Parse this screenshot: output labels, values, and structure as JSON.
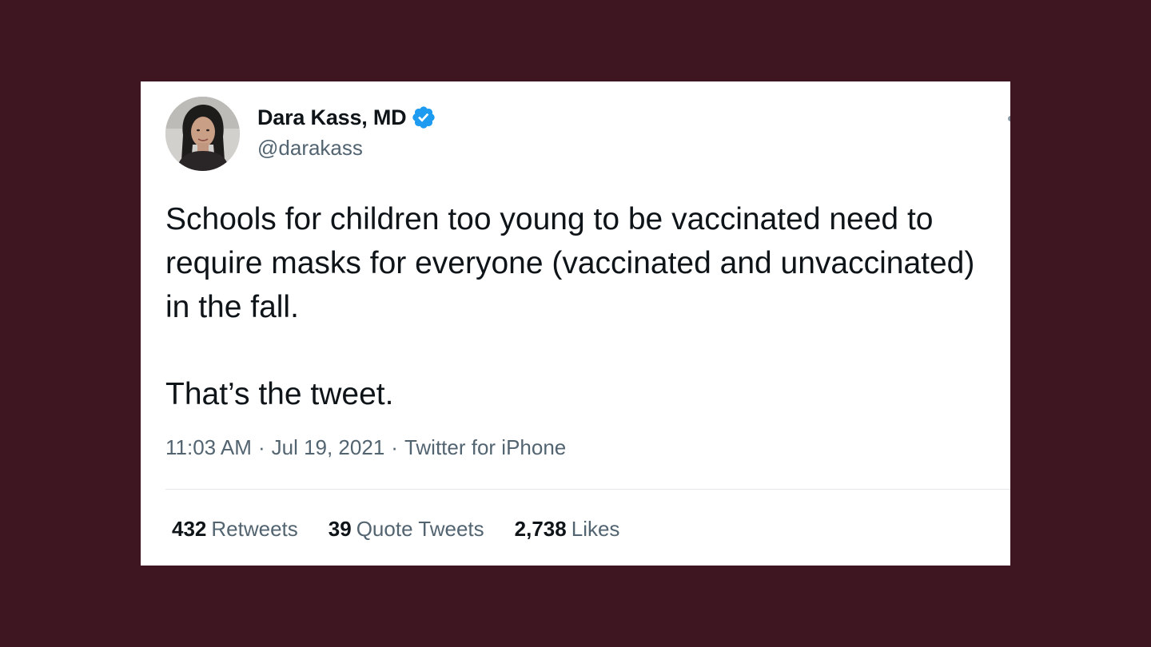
{
  "tweet": {
    "author": {
      "display_name": "Dara Kass, MD",
      "handle": "@darakass",
      "verified": true
    },
    "text_paragraphs": [
      "Schools for children too young to be vaccinated need to require masks for everyone (vaccinated and unvaccinated) in the fall.",
      "That’s the tweet."
    ],
    "meta": {
      "time": "11:03 AM",
      "separator": "·",
      "date": "Jul 19, 2021",
      "source": "Twitter for iPhone"
    },
    "stats": {
      "retweets": {
        "count": "432",
        "label": "Retweets"
      },
      "quote_tweets": {
        "count": "39",
        "label": "Quote Tweets"
      },
      "likes": {
        "count": "2,738",
        "label": "Likes"
      }
    }
  },
  "colors": {
    "background": "#3d1621",
    "card": "#ffffff",
    "text_primary": "#0f1419",
    "text_secondary": "#536471",
    "verified_badge": "#1d9bf0"
  },
  "icons": {
    "verified": "verified-badge-icon",
    "more": "more-options-icon"
  }
}
